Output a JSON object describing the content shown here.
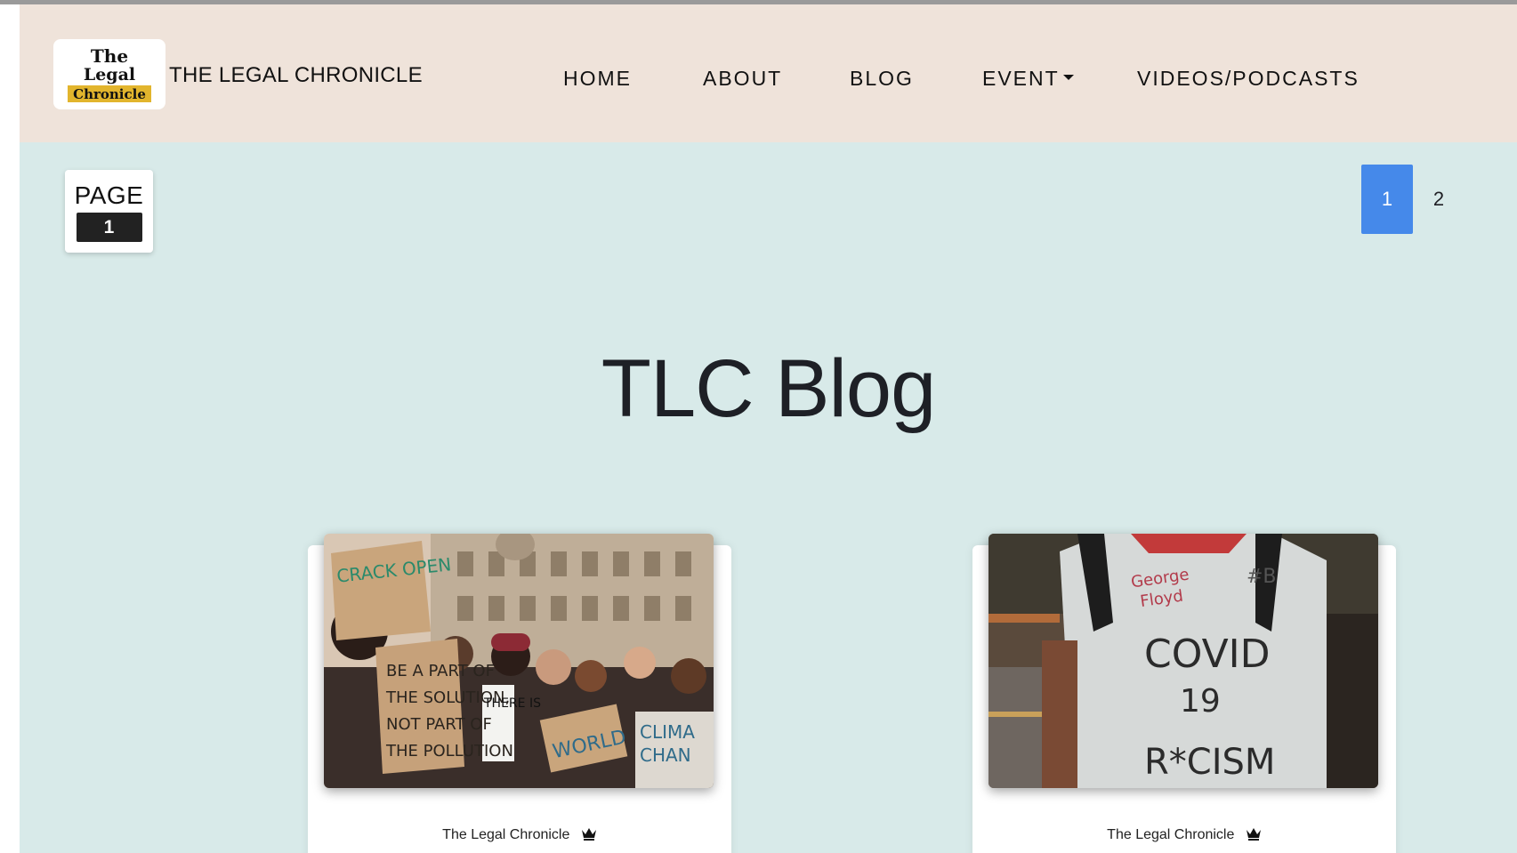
{
  "brand": {
    "logo_text": {
      "line1": "The",
      "line2": "Legal",
      "line3": "Chronicle"
    },
    "name": "THE LEGAL CHRONICLE"
  },
  "nav": {
    "home": "HOME",
    "about": "ABOUT",
    "blog": "BLOG",
    "event": "EVENT",
    "videos": "VIDEOS/PODCASTS"
  },
  "page_indicator": {
    "label": "PAGE",
    "number": "1"
  },
  "pagination": {
    "pages": [
      "1",
      "2"
    ],
    "active": "1"
  },
  "title": "TLC Blog",
  "cards": [
    {
      "author": "The Legal Chronicle",
      "image": {
        "description_icon": "protest-photo",
        "signs": [
          "CRACK OPEN",
          "BE A PART OF THE SOLUTION, NOT PART OF THE POLLUTION",
          "THERE IS NO PLANET",
          "IT'S A beautiful WORLD",
          "CLIMA CHAN"
        ]
      }
    },
    {
      "author": "The Legal Chronicle",
      "image": {
        "description_icon": "tshirt-photo",
        "shirt_text": [
          "George Floyd",
          "COVID 19",
          "R*CISM"
        ]
      }
    }
  ],
  "colors": {
    "navbar_bg": "#efe3da",
    "main_bg": "#d8eae9",
    "pager_active": "#4589ea",
    "logo_band": "#e2b52d"
  }
}
